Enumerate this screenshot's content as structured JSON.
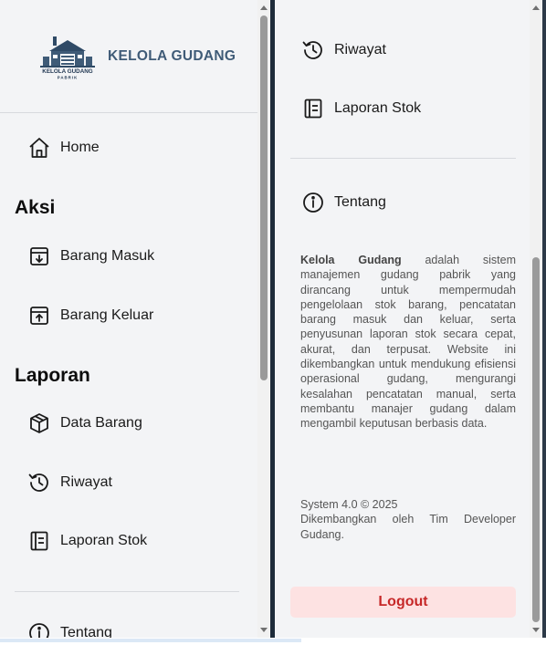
{
  "brand": {
    "name": "KELOLA GUDANG",
    "logo_text": "KELOLA GUDANG",
    "logo_subtext": "PABRIK"
  },
  "nav": {
    "home": "Home",
    "aksi_title": "Aksi",
    "barang_masuk": "Barang Masuk",
    "barang_keluar": "Barang Keluar",
    "laporan_title": "Laporan",
    "data_barang": "Data Barang",
    "riwayat": "Riwayat",
    "laporan_stok": "Laporan Stok",
    "tentang": "Tentang"
  },
  "about": {
    "lead": "Kelola Gudang",
    "text": "adalah sistem manajemen gudang pabrik yang dirancang untuk mempermudah pengelolaan stok barang, pencatatan barang masuk dan keluar, serta penyusunan laporan stok secara cepat, akurat, dan terpusat. Website ini dikembangkan untuk mendukung efisiensi operasional gudang, mengurangi kesalahan pencatatan manual, serta membantu manajer gudang dalam mengambil keputusan berbasis data.",
    "version": "System 4.0 © 2025",
    "credit": "Dikembangkan oleh Tim Developer Gudang."
  },
  "logout_label": "Logout",
  "colors": {
    "sidebar_bg": "#f3f4f6",
    "brand": "#3f5b77",
    "logout_bg": "#fde2e2",
    "logout_text": "#c62828"
  }
}
